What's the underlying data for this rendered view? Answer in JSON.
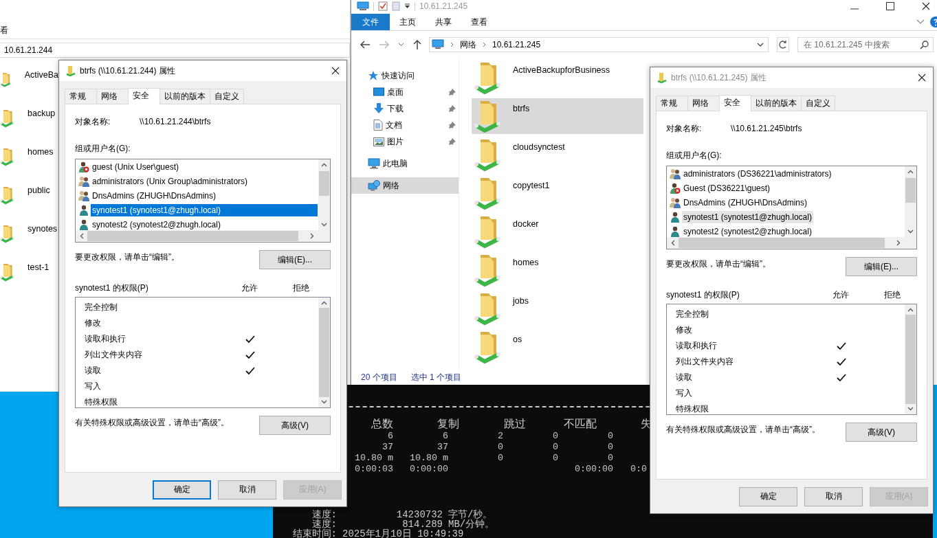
{
  "left_explorer": {
    "ribbon_tab": "看",
    "address": "10.61.21.244",
    "items": [
      {
        "name": "ActiveBa",
        "selected": false
      },
      {
        "name": "backup",
        "selected": false
      },
      {
        "name": "homes",
        "selected": false
      },
      {
        "name": "public",
        "selected": false
      },
      {
        "name": "synotes",
        "selected": false
      },
      {
        "name": "test-1",
        "selected": false
      }
    ]
  },
  "console": {
    "header": [
      "总数",
      "复制",
      "跳过",
      "不匹配",
      "失"
    ],
    "rows": [
      [
        "6",
        "6",
        "2",
        "0",
        "0",
        ""
      ],
      [
        "37",
        "37",
        "0",
        "0",
        "0",
        ""
      ],
      [
        "10.80 m",
        "10.80 m",
        "0",
        "0",
        "0",
        ""
      ],
      [
        "0:00:03",
        "0:00:00",
        "",
        "",
        "0:00:00",
        "0:0"
      ]
    ],
    "speed": [
      {
        "label": "速度:",
        "value": "14230732",
        "unit": "字节/秒。"
      },
      {
        "label": "速度:",
        "value": "814.289",
        "unit": "MB/分钟。"
      }
    ],
    "end": {
      "label": "结束时间:",
      "value": "2025年1月10日 10:49:39"
    }
  },
  "explorer": {
    "title": "10.61.21.245",
    "ribbon": [
      {
        "label": "文件",
        "kind": "file-menu"
      },
      {
        "label": "主页",
        "kind": "tab"
      },
      {
        "label": "共享",
        "kind": "tab"
      },
      {
        "label": "查看",
        "kind": "tab"
      }
    ],
    "breadcrumb": [
      "网络",
      "10.61.21.245"
    ],
    "search": {
      "placeholder": "在 10.61.21.245 中搜索"
    },
    "nav": [
      {
        "label": "快速访问",
        "kind": "quick-access",
        "selected": false,
        "children": [
          {
            "label": "桌面",
            "kind": "desktop",
            "selected": false,
            "pinned": true
          },
          {
            "label": "下载",
            "kind": "downloads",
            "selected": false,
            "pinned": true
          },
          {
            "label": "文档",
            "kind": "documents",
            "selected": false,
            "pinned": true
          },
          {
            "label": "图片",
            "kind": "pictures",
            "selected": false,
            "pinned": true
          }
        ]
      },
      {
        "label": "此电脑",
        "kind": "this-pc",
        "selected": false
      },
      {
        "label": "网络",
        "kind": "network",
        "selected": true
      }
    ],
    "items": [
      {
        "name": "ActiveBackupforBusiness",
        "selected": false
      },
      {
        "name": "btrfs",
        "selected": true
      },
      {
        "name": "cloudsynctest",
        "selected": false
      },
      {
        "name": "copytest1",
        "selected": false
      },
      {
        "name": "docker",
        "selected": false
      },
      {
        "name": "homes",
        "selected": false
      },
      {
        "name": "jobs",
        "selected": false
      },
      {
        "name": "os",
        "selected": false
      }
    ],
    "status": {
      "count": "20 个项目",
      "selection": "选中 1 个项目"
    }
  },
  "dialogs": [
    {
      "title": "btrfs (\\\\10.61.21.244) 属性",
      "active": true,
      "tabs": [
        {
          "label": "常规",
          "selected": false
        },
        {
          "label": "网络",
          "selected": false
        },
        {
          "label": "安全",
          "selected": true
        },
        {
          "label": "以前的版本",
          "selected": false
        },
        {
          "label": "自定义",
          "selected": false
        }
      ],
      "object_label": "对象名称:",
      "object_name": "\\\\10.61.21.244\\btrfs",
      "group_label": "组或用户名(G):",
      "principals": [
        {
          "name": "guest (Unix User\\guest)",
          "kind": "blocked-user",
          "selected": false
        },
        {
          "name": "administrators (Unix Group\\administrators)",
          "kind": "group",
          "selected": false
        },
        {
          "name": "DnsAdmins (ZHUGH\\DnsAdmins)",
          "kind": "group",
          "selected": false
        },
        {
          "name": "synotest1 (synotest1@zhugh.local)",
          "kind": "user",
          "selected": true
        },
        {
          "name": "synotest2 (synotest2@zhugh.local)",
          "kind": "user",
          "selected": false
        }
      ],
      "edit_hint": "要更改权限，请单击“编辑”。",
      "edit_button": "编辑(E)...",
      "perm_title": "synotest1 的权限(P)",
      "allow_label": "允许",
      "deny_label": "拒绝",
      "permissions": [
        {
          "name": "完全控制",
          "allow": false,
          "deny": false
        },
        {
          "name": "修改",
          "allow": false,
          "deny": false
        },
        {
          "name": "读取和执行",
          "allow": true,
          "deny": false
        },
        {
          "name": "列出文件夹内容",
          "allow": true,
          "deny": false
        },
        {
          "name": "读取",
          "allow": true,
          "deny": false
        },
        {
          "name": "写入",
          "allow": false,
          "deny": false
        },
        {
          "name": "特殊权限",
          "allow": false,
          "deny": false
        }
      ],
      "advanced_hint": "有关特殊权限或高级设置，请单击“高级”。",
      "advanced_button": "高级(V)",
      "buttons": [
        {
          "label": "确定",
          "default": true,
          "disabled": false
        },
        {
          "label": "取消",
          "default": false,
          "disabled": false
        },
        {
          "label": "应用(A)",
          "default": false,
          "disabled": true
        }
      ]
    },
    {
      "title": "btrfs (\\\\10.61.21.245) 属性",
      "active": false,
      "tabs": [
        {
          "label": "常规",
          "selected": false
        },
        {
          "label": "网络",
          "selected": false
        },
        {
          "label": "安全",
          "selected": true
        },
        {
          "label": "以前的版本",
          "selected": false
        },
        {
          "label": "自定义",
          "selected": false
        }
      ],
      "object_label": "对象名称:",
      "object_name": "\\\\10.61.21.245\\btrfs",
      "group_label": "组或用户名(G):",
      "principals": [
        {
          "name": "administrators (DS36221\\administrators)",
          "kind": "group",
          "selected": false
        },
        {
          "name": "Guest (DS36221\\guest)",
          "kind": "blocked-user",
          "selected": false
        },
        {
          "name": "DnsAdmins (ZHUGH\\DnsAdmins)",
          "kind": "group",
          "selected": false
        },
        {
          "name": "synotest1 (synotest1@zhugh.local)",
          "kind": "user",
          "selected": true
        },
        {
          "name": "synotest2 (synotest2@zhugh.local)",
          "kind": "user",
          "selected": false
        }
      ],
      "edit_hint": "要更改权限，请单击“编辑”。",
      "edit_button": "编辑(E)...",
      "perm_title": "synotest1 的权限(P)",
      "allow_label": "允许",
      "deny_label": "拒绝",
      "permissions": [
        {
          "name": "完全控制",
          "allow": false,
          "deny": false
        },
        {
          "name": "修改",
          "allow": false,
          "deny": false
        },
        {
          "name": "读取和执行",
          "allow": true,
          "deny": false
        },
        {
          "name": "列出文件夹内容",
          "allow": true,
          "deny": false
        },
        {
          "name": "读取",
          "allow": true,
          "deny": false
        },
        {
          "name": "写入",
          "allow": false,
          "deny": false
        },
        {
          "name": "特殊权限",
          "allow": false,
          "deny": false
        }
      ],
      "advanced_hint": "有关特殊权限或高级设置，请单击“高级”。",
      "advanced_button": "高级(V)",
      "buttons": [
        {
          "label": "确定",
          "disabled": false
        },
        {
          "label": "取消",
          "disabled": false
        },
        {
          "label": "应用(A)",
          "disabled": true
        }
      ]
    }
  ]
}
